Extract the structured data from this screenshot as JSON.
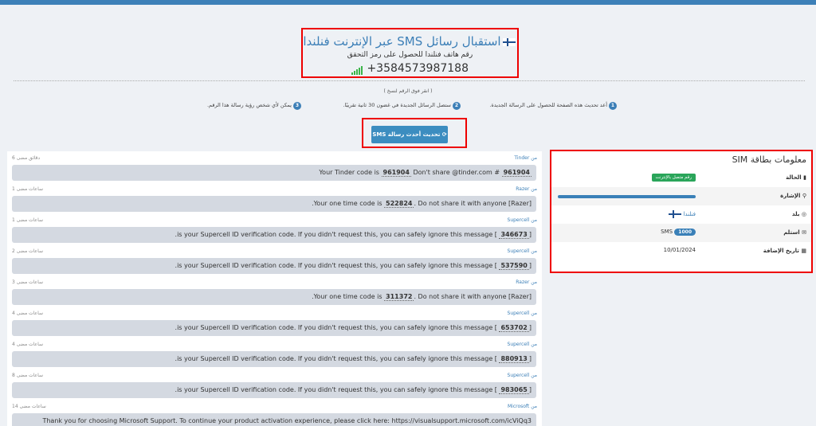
{
  "header": {
    "title": "استقبال رسائل SMS عبر الإنترنت فنلندا",
    "subtitle": "رقم هاتف فنلندا للحصول على رمز التحقق",
    "phone": "+3584573987188"
  },
  "hint": "( انقر فوق الرقم لنسخ )",
  "steps": [
    {
      "n": "1",
      "text": "أعد تحديث هذه الصفحة للحصول على الرسالة الجديدة."
    },
    {
      "n": "2",
      "text": "ستصل الرسائل الجديدة في غضون 30 ثانية تقريبًا."
    },
    {
      "n": "3",
      "text": "يمكن لأي شخص رؤية رسالة هذا الرقم."
    }
  ],
  "refresh_button": "⟳ تحديث أحدث رسالة SMS",
  "from_prefix": "من",
  "messages": [
    {
      "from": "Tinder",
      "time": "6 دقائق مضى",
      "pre": "Your Tinder code is ",
      "code": "961904",
      "post": " Don't share @tinder.com # ",
      "code2": "961904"
    },
    {
      "from": "Razer",
      "time": "1 ساعات مضى",
      "pre": ".Your one time code is ",
      "code": "522824",
      "post": ". Do not share it with anyone [Razer]"
    },
    {
      "from": "Supercell",
      "time": "1 ساعات مضى",
      "pre": ".is your Supercell ID verification code. If you didn't request this, you can safely ignore this message [ ",
      "code": "346673",
      "post": "]"
    },
    {
      "from": "Supercell",
      "time": "2 ساعات مضى",
      "pre": ".is your Supercell ID verification code. If you didn't request this, you can safely ignore this message [ ",
      "code": "537590",
      "post": "]"
    },
    {
      "from": "Razer",
      "time": "3 ساعات مضى",
      "pre": ".Your one time code is ",
      "code": "311372",
      "post": ". Do not share it with anyone [Razer]"
    },
    {
      "from": "Supercell",
      "time": "4 ساعات مضى",
      "pre": ".is your Supercell ID verification code. If you didn't request this, you can safely ignore this message [ ",
      "code": "653702",
      "post": "]"
    },
    {
      "from": "Supercell",
      "time": "4 ساعات مضى",
      "pre": ".is your Supercell ID verification code. If you didn't request this, you can safely ignore this message [ ",
      "code": "880913",
      "post": "]"
    },
    {
      "from": "Supercell",
      "time": "8 ساعات مضى",
      "pre": ".is your Supercell ID verification code. If you didn't request this, you can safely ignore this message [ ",
      "code": "983065",
      "post": "]"
    },
    {
      "from": "Microsoft",
      "time": "14 ساعات مضى",
      "pre": "Thank you for choosing Microsoft Support. To continue your product activation experience, please click here: https://visualsupport.microsoft.com/icViQq3",
      "code": "",
      "post": ""
    }
  ],
  "sim": {
    "title": "معلومات بطاقة SIM",
    "status_label": "الحالة",
    "status_value": "رقم متصل بالإنترنت",
    "signal_label": "الإشارة",
    "signal_level": 1.0,
    "country_label": "بلد",
    "country_value": "فنلندا",
    "received_label": "استلم",
    "received_count": "1000",
    "received_unit": "SMS",
    "date_label": "تاريخ الإضافة",
    "date_value": "10/01/2024"
  },
  "colors": {
    "accent": "#3c7fb7",
    "status_green": "#2aa55a",
    "highlight": "#e00000"
  }
}
